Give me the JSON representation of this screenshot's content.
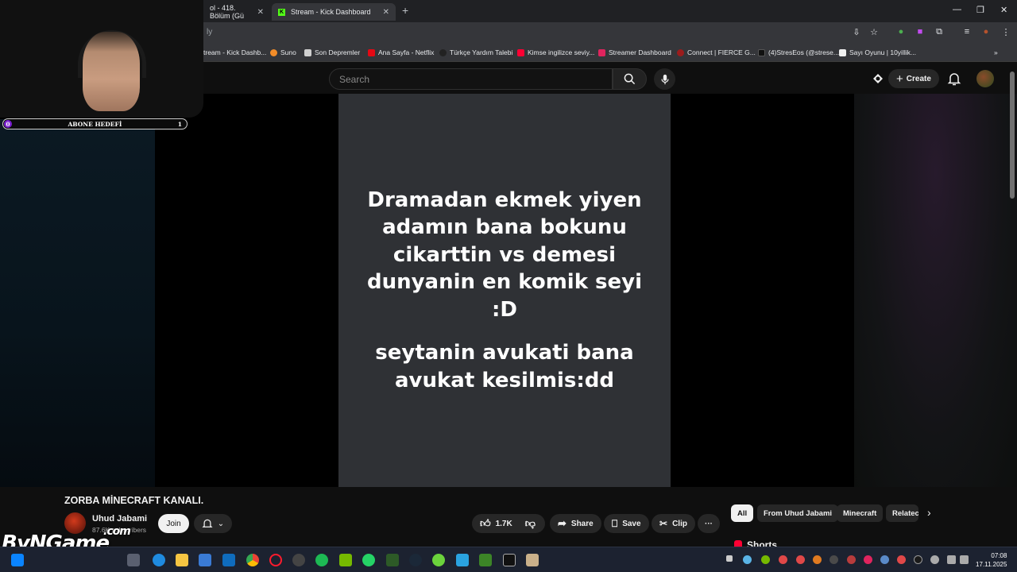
{
  "browser": {
    "tabs": [
      {
        "label": "ol - 418. Bölüm (Gü"
      },
      {
        "label": "Stream - Kick Dashboard"
      }
    ],
    "address_partial": "ly",
    "bookmarks": [
      "tream - Kick Dashb...",
      "Suno",
      "Son Depremler",
      "Ana Sayfa - Netflix",
      "Türkçe Yardım Talebi",
      "Kimse ingilizce seviy...",
      "Streamer Dashboard",
      "Connect | FIERCE G...",
      "(4)StresEos (@strese...",
      "Sayı Oyunu | 10yillik..."
    ]
  },
  "youtube": {
    "search_placeholder": "Search",
    "create_label": "Create",
    "short_text_1": "Dramadan ekmek yiyen adamın bana bokunu cikarttin vs demesi dunyanin en komik seyi :D",
    "short_text_2": "seytanin avukati bana avukat kesilmis:dd",
    "video_title": "ZORBA MİNECRAFT KANALI.",
    "channel_name": "Uhud Jabami",
    "subscribers": "87.6K subscribers",
    "join_label": "Join",
    "likes": "1.7K",
    "share_label": "Share",
    "save_label": "Save",
    "clip_label": "Clip",
    "chips": [
      "All",
      "From Uhud Jabami",
      "Minecraft",
      "Relatec"
    ],
    "shorts_heading": "Shorts"
  },
  "overlay": {
    "goal_label": "ABONE HEDEFİ",
    "goal_current": "0",
    "goal_target": "1",
    "watermark": "ByNGame",
    "watermark_suffix": ".com"
  },
  "taskbar": {
    "time": "07:08",
    "date": "17.11.2025"
  }
}
